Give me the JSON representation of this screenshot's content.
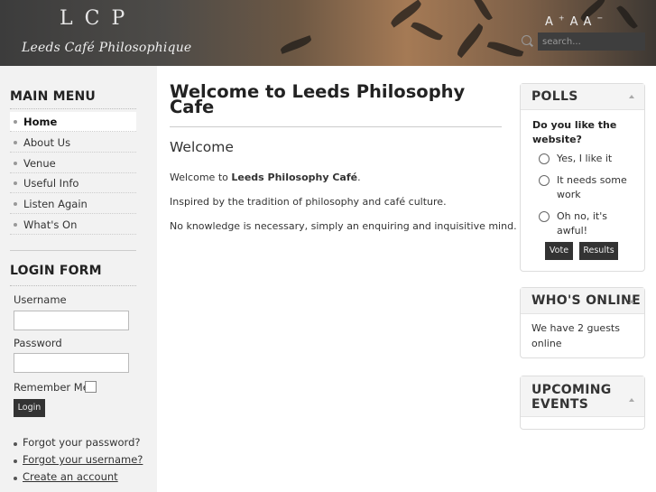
{
  "header": {
    "logo": "LCP",
    "site_name": "Leeds Café Philosophique",
    "font_sizer": {
      "increase": "A",
      "increase_mark": "+",
      "reset": "A",
      "decrease": "A",
      "decrease_mark": "−"
    },
    "search": {
      "placeholder": "search..."
    }
  },
  "main_menu": {
    "title": "MAIN MENU",
    "items": [
      {
        "label": "Home",
        "active": true
      },
      {
        "label": "About Us"
      },
      {
        "label": "Venue"
      },
      {
        "label": "Useful Info"
      },
      {
        "label": "Listen Again"
      },
      {
        "label": "What's On"
      }
    ]
  },
  "login_form": {
    "title": "LOGIN FORM",
    "username_label": "Username",
    "password_label": "Password",
    "remember_label": "Remember Me",
    "login_button": "Login",
    "links": [
      {
        "label": "Forgot your password?"
      },
      {
        "label": "Forgot your username?"
      },
      {
        "label": "Create an account"
      }
    ]
  },
  "main": {
    "title": "Welcome to Leeds Philosophy Cafe",
    "subtitle": "Welcome",
    "p1_prefix": "Welcome to ",
    "p1_bold": "Leeds Philosophy Café",
    "p1_suffix": ".",
    "p2": "Inspired by the tradition of philosophy and café culture.",
    "p3": "No knowledge is necessary, simply an enquiring and inquisitive mind."
  },
  "polls": {
    "title": "POLLS",
    "question": "Do you like the website?",
    "options": [
      "Yes, I like it",
      "It needs some work",
      "Oh no, it's awful!"
    ],
    "vote_button": "Vote",
    "results_button": "Results"
  },
  "whos_online": {
    "title": "WHO'S ONLINE",
    "text": "We have 2 guests online"
  },
  "upcoming_events": {
    "title": "UPCOMING EVENTS"
  }
}
